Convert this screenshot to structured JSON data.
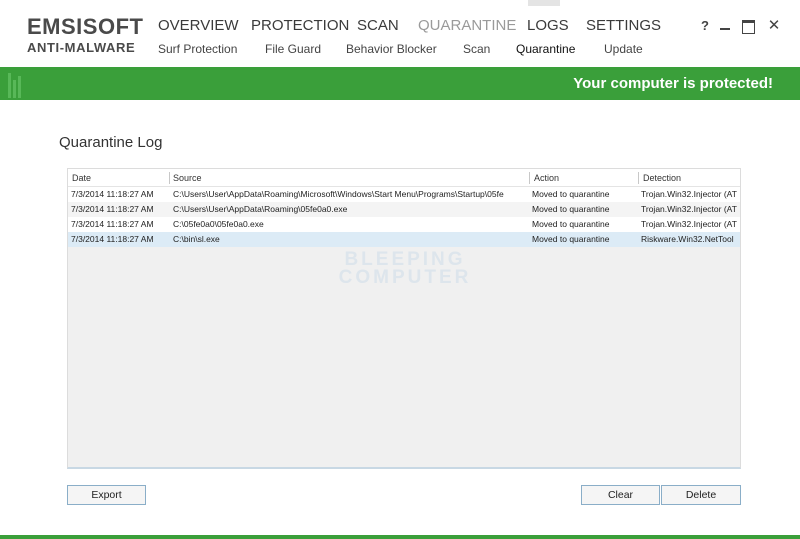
{
  "brand": {
    "line1": "EMSISOFT",
    "line2": "ANTI-MALWARE"
  },
  "nav": {
    "main": [
      "OVERVIEW",
      "PROTECTION",
      "SCAN",
      "QUARANTINE",
      "LOGS",
      "SETTINGS"
    ],
    "active_main": "QUARANTINE",
    "sub": [
      "Surf Protection",
      "File Guard",
      "Behavior Blocker",
      "Scan",
      "Quarantine",
      "Update"
    ],
    "active_sub": "Quarantine"
  },
  "window_controls": {
    "help": "?",
    "close": "✕"
  },
  "status": {
    "text": "Your computer is protected!",
    "color": "#3a9f3a"
  },
  "page": {
    "title": "Quarantine Log"
  },
  "table": {
    "columns": [
      "Date",
      "Source",
      "Action",
      "Detection"
    ],
    "rows": [
      {
        "date": "7/3/2014 11:18:27 AM",
        "source": "C:\\Users\\User\\AppData\\Roaming\\Microsoft\\Windows\\Start Menu\\Programs\\Startup\\05fe",
        "action": "Moved to quarantine",
        "detection": "Trojan.Win32.Injector (AT"
      },
      {
        "date": "7/3/2014 11:18:27 AM",
        "source": "C:\\Users\\User\\AppData\\Roaming\\05fe0a0.exe",
        "action": "Moved to quarantine",
        "detection": "Trojan.Win32.Injector (AT"
      },
      {
        "date": "7/3/2014 11:18:27 AM",
        "source": "C:\\05fe0a0\\05fe0a0.exe",
        "action": "Moved to quarantine",
        "detection": "Trojan.Win32.Injector (AT"
      },
      {
        "date": "7/3/2014 11:18:27 AM",
        "source": "C:\\bin\\sl.exe",
        "action": "Moved to quarantine",
        "detection": "Riskware.Win32.NetTool"
      }
    ],
    "selected_row": 4
  },
  "watermark": {
    "line1": "BLEEPING",
    "line2": "COMPUTER"
  },
  "buttons": {
    "export": "Export",
    "clear": "Clear",
    "delete": "Delete"
  }
}
